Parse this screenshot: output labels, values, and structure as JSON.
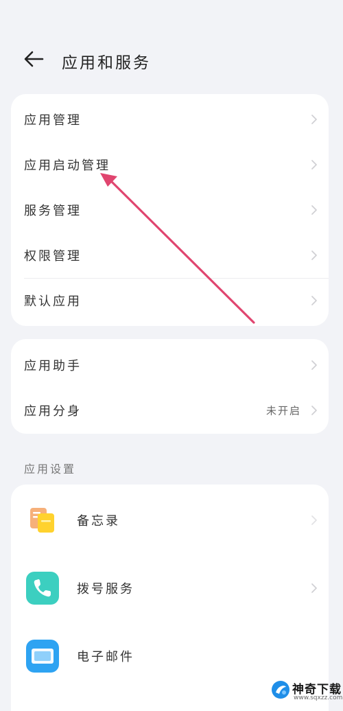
{
  "header": {
    "title": "应用和服务"
  },
  "group1": {
    "items": [
      {
        "label": "应用管理"
      },
      {
        "label": "应用启动管理"
      },
      {
        "label": "服务管理"
      },
      {
        "label": "权限管理"
      },
      {
        "label": "默认应用"
      }
    ]
  },
  "group2": {
    "items": [
      {
        "label": "应用助手"
      },
      {
        "label": "应用分身",
        "value": "未开启"
      }
    ]
  },
  "app_settings": {
    "title": "应用设置",
    "items": [
      {
        "label": "备忘录",
        "icon": "memo-icon"
      },
      {
        "label": "拨号服务",
        "icon": "phone-icon"
      },
      {
        "label": "电子邮件",
        "icon": "email-icon"
      }
    ]
  },
  "watermark": {
    "name": "神奇下载",
    "url": "www.sqxzz.com"
  },
  "colors": {
    "background": "#f2f3f7",
    "card": "#ffffff",
    "arrow": "#e0456f",
    "phone_teal": "#3ccfc0",
    "email_blue": "#2ea3f2"
  }
}
